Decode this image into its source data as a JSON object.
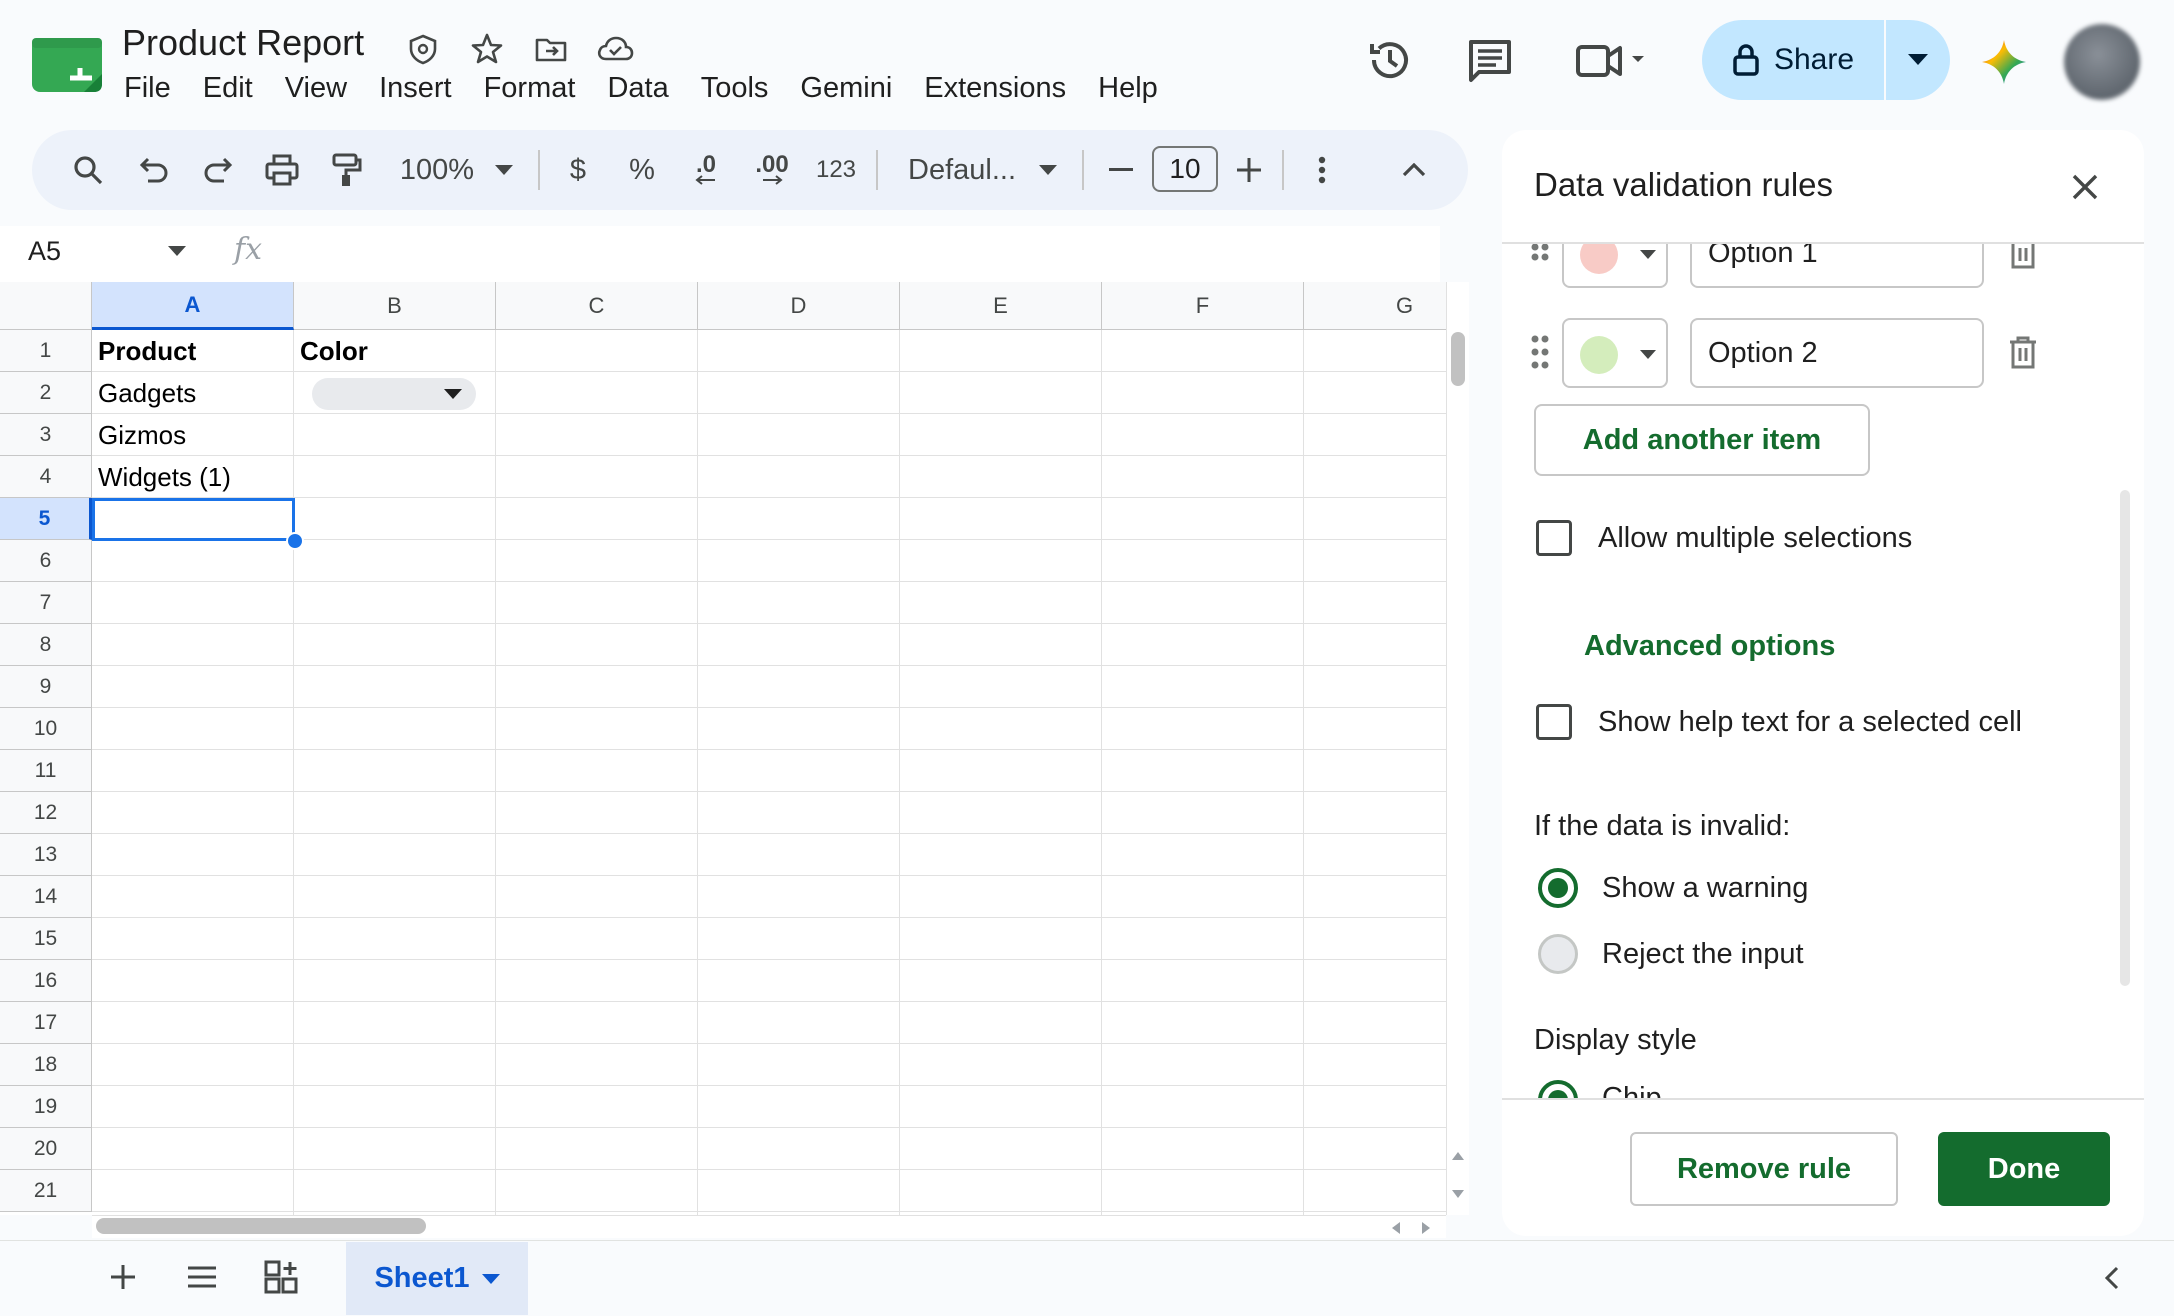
{
  "header": {
    "title": "Product Report",
    "menu": [
      "File",
      "Edit",
      "View",
      "Insert",
      "Format",
      "Data",
      "Tools",
      "Gemini",
      "Extensions",
      "Help"
    ],
    "share_label": "Share"
  },
  "toolbar": {
    "zoom": "100%",
    "currency": "$",
    "percent": "%",
    "decrease_decimal": ".0",
    "increase_decimal": ".00",
    "number_format": "123",
    "font": "Defaul...",
    "font_size": "10"
  },
  "formula_bar": {
    "name_box": "A5",
    "fx": "fx"
  },
  "grid": {
    "columns": [
      "A",
      "B",
      "C",
      "D",
      "E",
      "F",
      "G"
    ],
    "rows": [
      "1",
      "2",
      "3",
      "4",
      "5",
      "6",
      "7",
      "8",
      "9",
      "10",
      "11",
      "12",
      "13",
      "14",
      "15",
      "16",
      "17",
      "18",
      "19",
      "20",
      "21"
    ],
    "selected_column": "A",
    "selected_row": "5",
    "cells": {
      "A1": "Product",
      "B1": "Color",
      "A2": "Gadgets",
      "A3": "Gizmos",
      "A4": "Widgets (1)"
    }
  },
  "sheets": {
    "active": "Sheet1"
  },
  "panel": {
    "title": "Data validation rules",
    "options": [
      {
        "value": "Option 1",
        "color": "#f8cbc6"
      },
      {
        "value": "Option 2",
        "color": "#d4edbc"
      }
    ],
    "add_item": "Add another item",
    "allow_multiple": "Allow multiple selections",
    "advanced": "Advanced options",
    "help_text": "Show help text for a selected cell",
    "invalid_heading": "If the data is invalid:",
    "invalid_options": [
      "Show a warning",
      "Reject the input"
    ],
    "display_heading": "Display style",
    "display_first": "Chip",
    "remove_rule": "Remove rule",
    "done": "Done"
  },
  "colors": {
    "accent_green": "#146c2e",
    "selection_blue": "#1a73e8",
    "share_bg": "#c2e7ff"
  }
}
